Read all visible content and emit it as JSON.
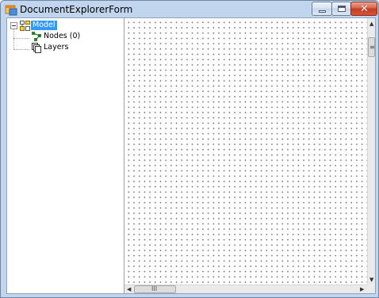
{
  "window": {
    "title": "DocumentExplorerForm",
    "controls": [
      "minimize",
      "maximize",
      "close"
    ]
  },
  "tree": {
    "root": {
      "label": "Model",
      "selected": true,
      "expanded": true
    },
    "children": [
      {
        "label": "Nodes (0)"
      },
      {
        "label": "Layers"
      }
    ]
  },
  "scrollbars": {
    "horizontal_thumb_grip": "III",
    "vertical_thumb_grip": "≡"
  },
  "icons": {
    "app": "app-form-icon",
    "root": "model-icon",
    "nodes": "nodes-icon",
    "layers": "layers-icon"
  },
  "colors": {
    "selection": "#3399ff",
    "titlebar": "#c2d5ee",
    "close_button": "#c43c1d"
  }
}
